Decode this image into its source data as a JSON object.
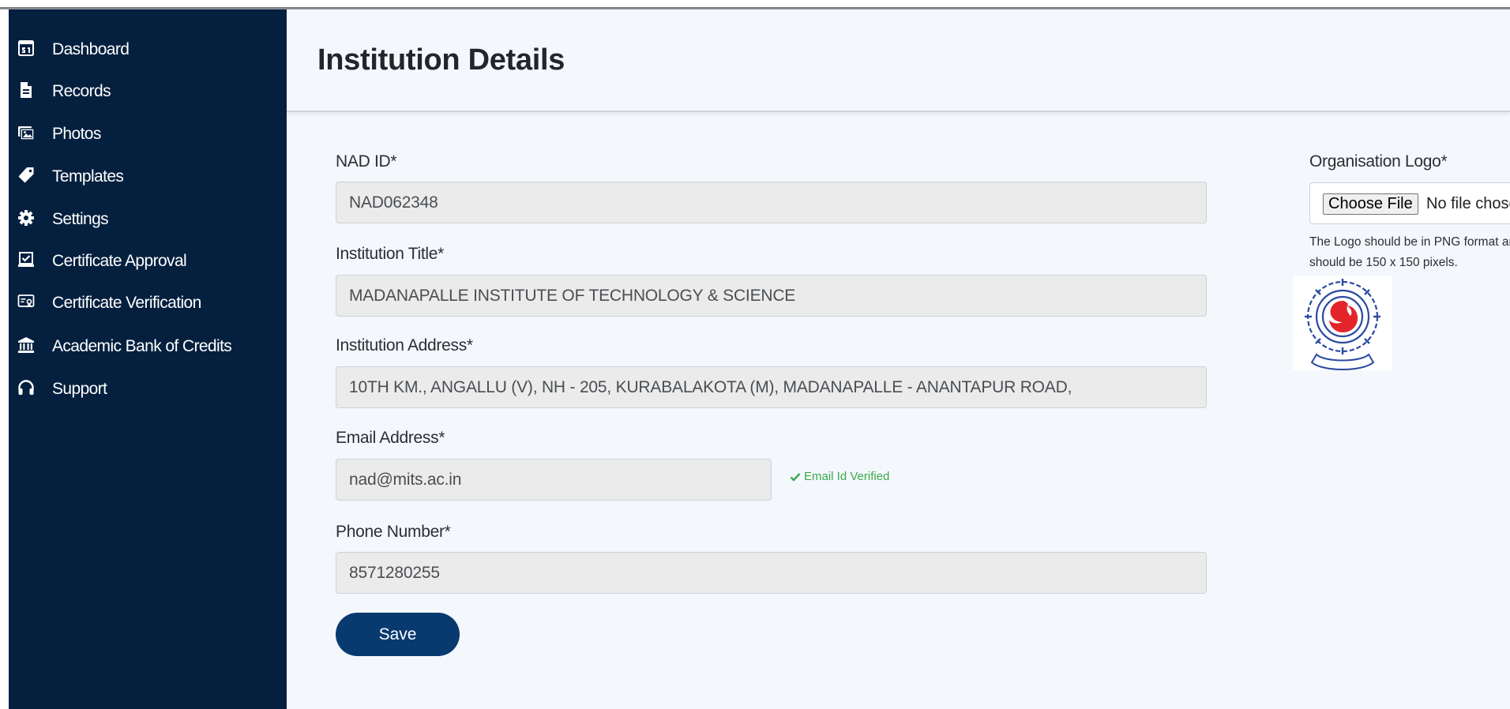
{
  "sidebar": {
    "items": [
      {
        "label": "Dashboard",
        "icon": "dashboard-icon"
      },
      {
        "label": "Records",
        "icon": "file-icon"
      },
      {
        "label": "Photos",
        "icon": "photos-icon"
      },
      {
        "label": "Templates",
        "icon": "tag-icon"
      },
      {
        "label": "Settings",
        "icon": "gear-icon"
      },
      {
        "label": "Certificate Approval",
        "icon": "approval-icon"
      },
      {
        "label": "Certificate Verification",
        "icon": "certificate-icon"
      },
      {
        "label": "Academic Bank of Credits",
        "icon": "bank-icon"
      },
      {
        "label": "Support",
        "icon": "headset-icon"
      }
    ]
  },
  "page": {
    "title": "Institution Details"
  },
  "form": {
    "nad_id": {
      "label": "NAD ID*",
      "value": "NAD062348"
    },
    "institution_title": {
      "label": "Institution Title*",
      "value": "MADANAPALLE INSTITUTE OF TECHNOLOGY & SCIENCE"
    },
    "institution_address": {
      "label": "Institution Address*",
      "value": "10TH KM., ANGALLU (V), NH - 205, KURABALAKOTA (M), MADANAPALLE - ANANTAPUR ROAD,"
    },
    "email": {
      "label": "Email Address*",
      "value": "nad@mits.ac.in",
      "verified_text": "Email Id Verified"
    },
    "phone": {
      "label": "Phone Number*",
      "value": "8571280255"
    },
    "save_label": "Save"
  },
  "logo": {
    "label": "Organisation Logo*",
    "choose_label": "Choose File",
    "no_file_text": "No file chosen",
    "help_line1": "The Logo should be in PNG format and",
    "help_line2": "should be 150 x 150 pixels."
  },
  "colors": {
    "sidebar_bg": "#05203f",
    "main_bg": "#f4f7fc",
    "save_button": "#083a70",
    "verified_green": "#3aaa4a",
    "logo_red": "#e3242b",
    "logo_blue": "#2a4aa0"
  }
}
